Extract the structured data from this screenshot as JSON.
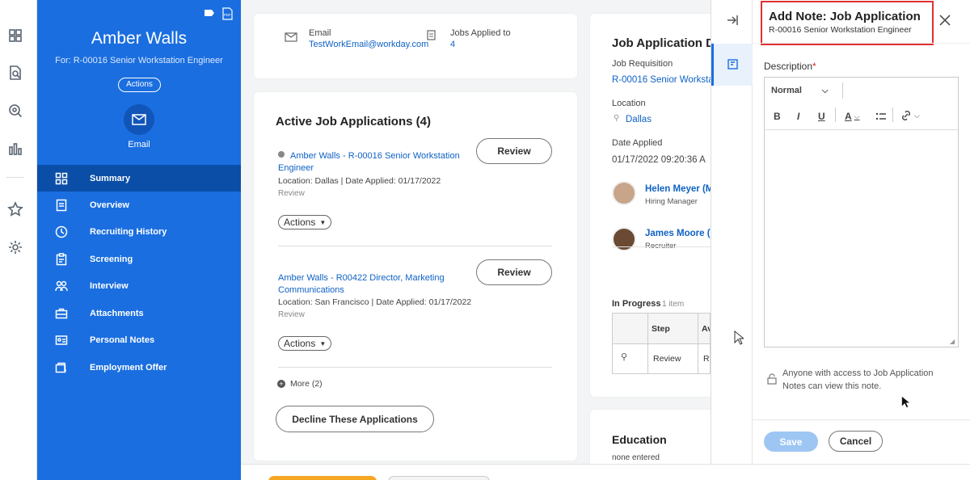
{
  "sidebar": {
    "name": "Amber Walls",
    "for_text": "For: R-00016 Senior Workstation Engineer",
    "actions_label": "Actions",
    "email_label": "Email",
    "nav": [
      {
        "label": "Summary"
      },
      {
        "label": "Overview"
      },
      {
        "label": "Recruiting History"
      },
      {
        "label": "Screening"
      },
      {
        "label": "Interview"
      },
      {
        "label": "Attachments"
      },
      {
        "label": "Personal Notes"
      },
      {
        "label": "Employment Offer"
      }
    ]
  },
  "contact": {
    "email_label": "Email",
    "email_value": "TestWorkEmail@workday.com",
    "jobs_label": "Jobs Applied to",
    "jobs_value": "4"
  },
  "active_apps": {
    "title": "Active Job Applications (4)",
    "apps": [
      {
        "title": "Amber Walls - R-00016 Senior Workstation Engineer",
        "location": "Location: Dallas | Date Applied: 01/17/2022",
        "stage": "Review",
        "review_label": "Review",
        "actions_label": "Actions"
      },
      {
        "title": "Amber Walls - R00422 Director, Marketing Communications",
        "location": "Location: San Francisco | Date Applied: 01/17/2022",
        "stage": "Review",
        "review_label": "Review",
        "actions_label": "Actions"
      }
    ],
    "more_label": "More (2)",
    "decline_label": "Decline These Applications"
  },
  "job_details": {
    "title": "Job Application D",
    "req_label": "Job Requisition",
    "req_value": "R-00016 Senior Workstat",
    "location_label": "Location",
    "location_value": "Dallas",
    "date_label": "Date Applied",
    "date_value": "01/17/2022 09:20:36 A",
    "people": [
      {
        "name": "Helen Meyer (M",
        "role": "Hiring Manager"
      },
      {
        "name": "James Moore (",
        "role": "Recruiter"
      }
    ],
    "in_progress_label": "In Progress",
    "in_progress_count": "1 item",
    "table_headers": [
      "Step",
      "Av"
    ],
    "table_row": [
      "Review",
      "Re"
    ]
  },
  "education": {
    "title": "Education",
    "value": "none entered"
  },
  "drawer": {
    "title": "Add Note: Job Application",
    "subtitle": "R-00016 Senior Workstation Engineer",
    "description_label": "Description",
    "required_mark": "*",
    "format_value": "Normal",
    "access_note": "Anyone with access to Job Application Notes can view this note.",
    "save_label": "Save",
    "cancel_label": "Cancel"
  },
  "colors": {
    "sidebar_blue": "#1a6ee0",
    "sidebar_active": "#0b4ea8",
    "link_blue": "#0f62c4",
    "highlight_red": "#e03030",
    "save_disabled": "#9ec6f3"
  },
  "icons": [
    "grid-icon",
    "search-doc-icon",
    "zoom-icon",
    "chart-icon",
    "star-icon",
    "gear-icon",
    "tag-icon",
    "pdf-icon",
    "mail-icon",
    "location-pin-icon",
    "lock-icon",
    "close-icon",
    "collapse-icon",
    "note-icon"
  ]
}
